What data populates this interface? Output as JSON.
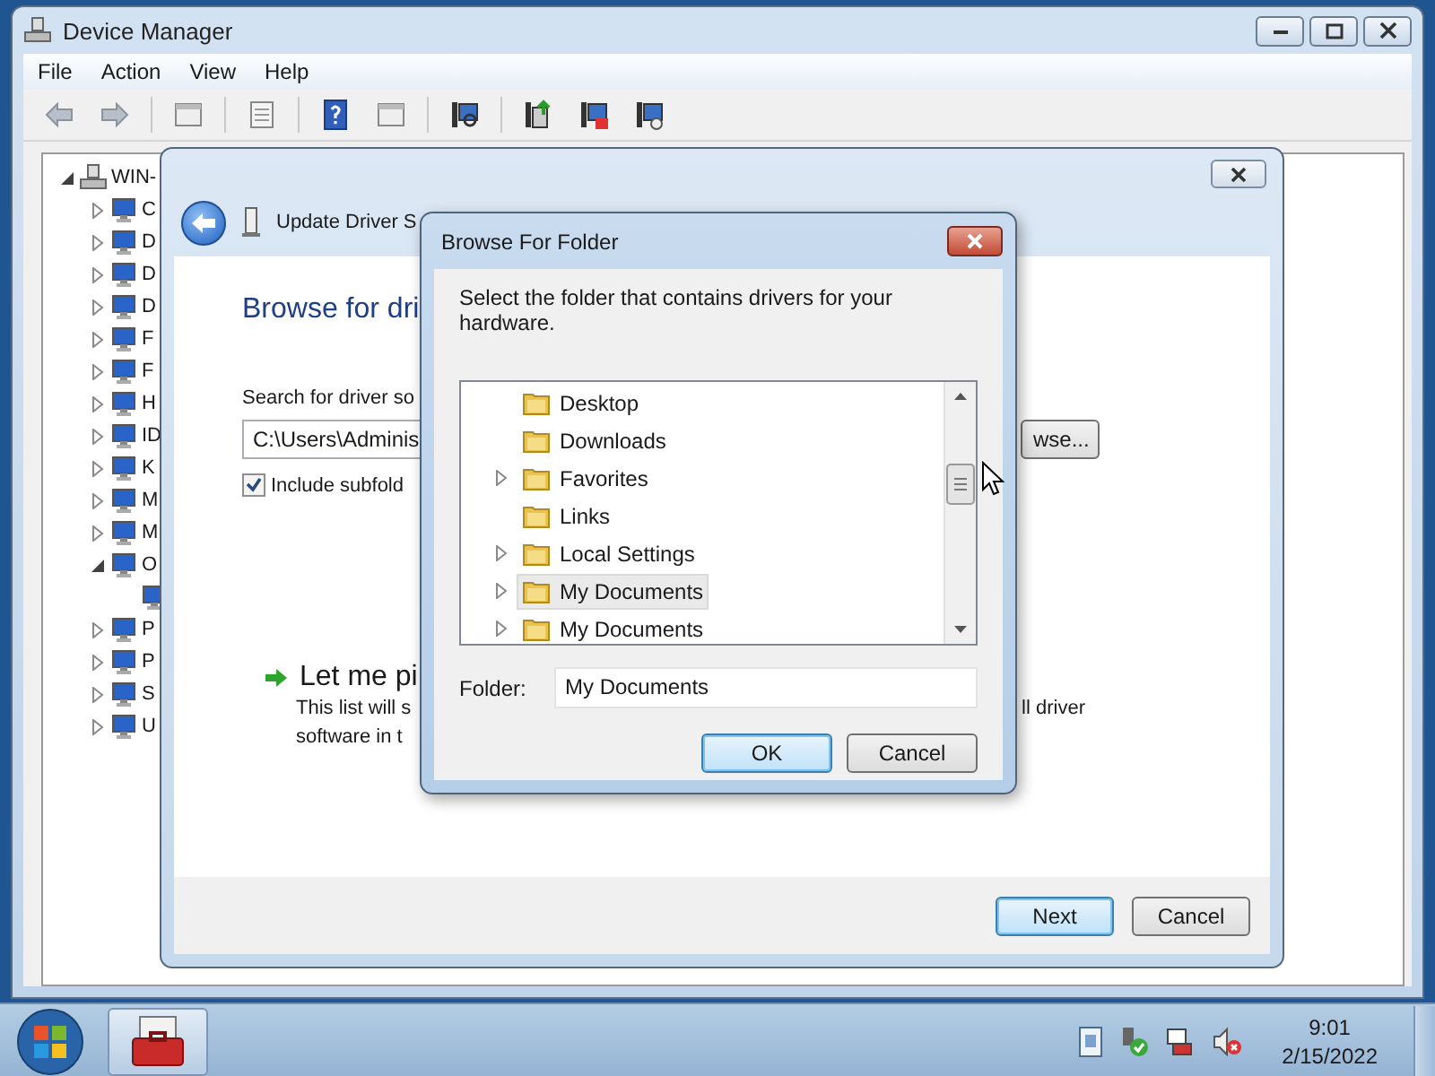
{
  "device_manager": {
    "title": "Device Manager",
    "menu": [
      "File",
      "Action",
      "View",
      "Help"
    ],
    "tree": {
      "label": "WIN-",
      "expandable": true,
      "expanded": true,
      "children": [
        {
          "label": "C",
          "expandable": true,
          "expanded": false
        },
        {
          "label": "D",
          "expandable": true,
          "expanded": false
        },
        {
          "label": "D",
          "expandable": true,
          "expanded": false
        },
        {
          "label": "D",
          "expandable": true,
          "expanded": false
        },
        {
          "label": "F",
          "expandable": true,
          "expanded": false
        },
        {
          "label": "F",
          "expandable": true,
          "expanded": false
        },
        {
          "label": "H",
          "expandable": true,
          "expanded": false
        },
        {
          "label": "ID",
          "expandable": true,
          "expanded": false
        },
        {
          "label": "K",
          "expandable": true,
          "expanded": false
        },
        {
          "label": "M",
          "expandable": true,
          "expanded": false
        },
        {
          "label": "M",
          "expandable": true,
          "expanded": false
        },
        {
          "label": "O",
          "expandable": true,
          "expanded": true,
          "children": [
            {
              "expandable": false,
              "expanded": false
            }
          ]
        },
        {
          "label": "P",
          "expandable": true,
          "expanded": false
        },
        {
          "label": "P",
          "expandable": true,
          "expanded": false
        },
        {
          "label": "S",
          "expandable": true,
          "expanded": false
        },
        {
          "label": "U",
          "expandable": true,
          "expanded": false
        }
      ]
    }
  },
  "wizard": {
    "title": "Update Driver S",
    "heading": "Browse for dri",
    "search_label": "Search for driver so",
    "path": "C:\\Users\\Adminis",
    "browse_button": "wse...",
    "include_subfolders": {
      "label": "Include subfold",
      "checked": true
    },
    "link": "Let me pi",
    "description": [
      "This list will s",
      "software in t"
    ],
    "description_right": "ll driver",
    "buttons": [
      {
        "label": "Next",
        "default": true
      },
      {
        "label": "Cancel",
        "default": false
      }
    ]
  },
  "browse_dialog": {
    "title": "Browse For Folder",
    "prompt": "Select the folder that contains drivers for your hardware.",
    "folders": [
      {
        "label": "Desktop",
        "expandable": false,
        "selected": false
      },
      {
        "label": "Downloads",
        "expandable": false,
        "selected": false
      },
      {
        "label": "Favorites",
        "expandable": true,
        "selected": false
      },
      {
        "label": "Links",
        "expandable": false,
        "selected": false
      },
      {
        "label": "Local Settings",
        "expandable": true,
        "selected": false
      },
      {
        "label": "My Documents",
        "expandable": true,
        "selected": true
      },
      {
        "label": "My Documents",
        "expandable": true,
        "selected": false
      }
    ],
    "folder_label": "Folder:",
    "folder_value": "My Documents",
    "buttons": [
      {
        "label": "OK",
        "default": true
      },
      {
        "label": "Cancel",
        "default": false
      }
    ]
  },
  "taskbar": {
    "time": "9:01",
    "date": "2/15/2022"
  }
}
